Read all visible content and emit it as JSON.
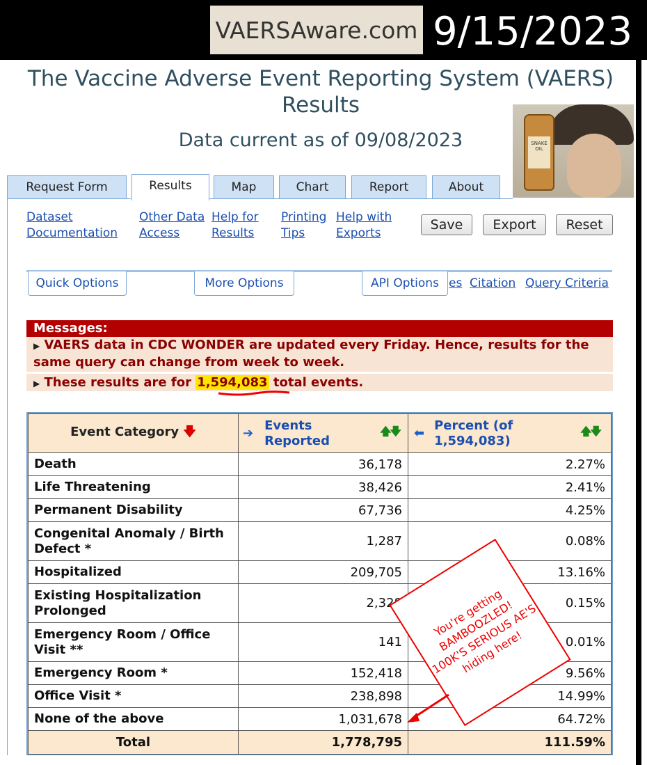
{
  "banner": {
    "brand": "VAERSAware.com",
    "date": "9/15/2023"
  },
  "header": {
    "title_line1": "The Vaccine Adverse Event Reporting System (VAERS)",
    "title_line2": "Results",
    "subtitle": "Data current as of 09/08/2023"
  },
  "image": {
    "bottle_label": "SNAKE OIL"
  },
  "tabs": [
    "Request Form",
    "Results",
    "Map",
    "Chart",
    "Report",
    "About"
  ],
  "links": {
    "dataset_l1": "Dataset",
    "dataset_l2": "Documentation",
    "other_l1": "Other Data",
    "other_l2": "Access",
    "help_results_l1": "Help for",
    "help_results_l2": "Results",
    "printing_l1": "Printing",
    "printing_l2": "Tips",
    "help_exports_l1": "Help with",
    "help_exports_l2": "Exports"
  },
  "buttons": {
    "save": "Save",
    "export": "Export",
    "reset": "Reset"
  },
  "options": {
    "quick": "Quick Options",
    "more": "More Options",
    "api": "API Options",
    "notes_partial": "es",
    "citation": "Citation",
    "query_criteria": "Query Criteria"
  },
  "messages": {
    "heading": "Messages:",
    "msg1": "VAERS data in CDC WONDER are updated every Friday. Hence, results for the same query can change from week to week.",
    "msg2_prefix": "These results are for",
    "msg2_value": "1,594,083",
    "msg2_suffix": "total events."
  },
  "table": {
    "headers": {
      "category": "Event Category",
      "events_l1": "Events",
      "events_l2": "Reported",
      "percent_l1": "Percent (of",
      "percent_l2": "1,594,083)"
    },
    "rows": [
      {
        "category": "Death",
        "events": "36,178",
        "percent": "2.27%"
      },
      {
        "category": "Life Threatening",
        "events": "38,426",
        "percent": "2.41%"
      },
      {
        "category": "Permanent Disability",
        "events": "67,736",
        "percent": "4.25%"
      },
      {
        "category": "Congenital Anomaly / Birth Defect *",
        "events": "1,287",
        "percent": "0.08%"
      },
      {
        "category": "Hospitalized",
        "events": "209,705",
        "percent": "13.16%"
      },
      {
        "category": "Existing Hospitalization Prolonged",
        "events": "2,328",
        "percent": "0.15%"
      },
      {
        "category": "Emergency Room / Office Visit **",
        "events": "141",
        "percent": "0.01%"
      },
      {
        "category": "Emergency Room *",
        "events": "152,418",
        "percent": "9.56%"
      },
      {
        "category": "Office Visit *",
        "events": "238,898",
        "percent": "14.99%"
      },
      {
        "category": "None of the above",
        "events": "1,031,678",
        "percent": "64.72%"
      }
    ],
    "total": {
      "category": "Total",
      "events": "1,778,795",
      "percent": "111.59%"
    }
  },
  "callout": {
    "line1": "You're getting",
    "line2": "BAMBOOZLED!",
    "line3": "100K'S SERIOUS AE'S",
    "line4": "hiding here!"
  }
}
